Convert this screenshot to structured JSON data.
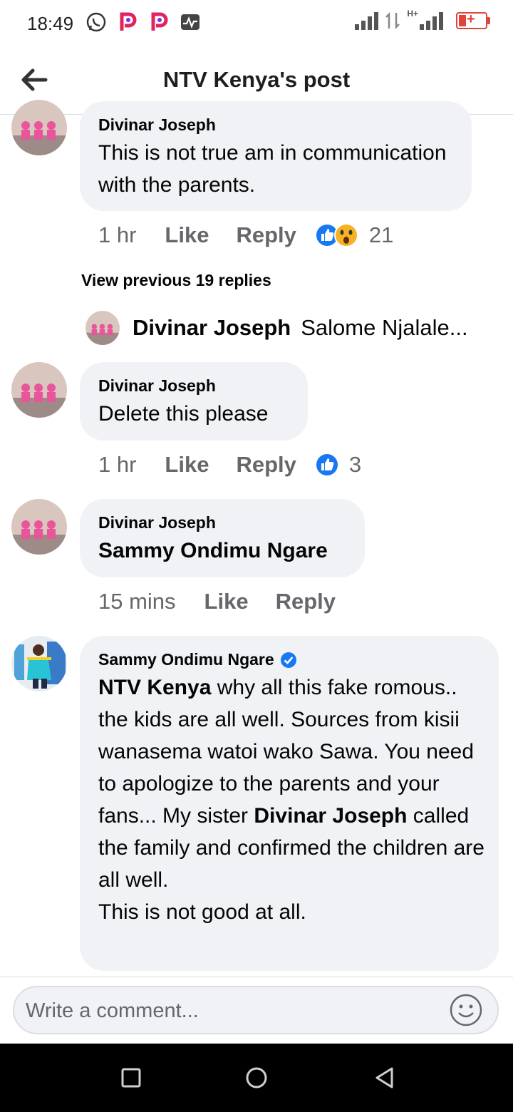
{
  "status_bar": {
    "time": "18:49",
    "network_label": "H+"
  },
  "header": {
    "title": "NTV Kenya's post",
    "back_icon": "back-arrow-icon"
  },
  "comments": [
    {
      "author": "Divinar Joseph",
      "text": "This is not true am in communication with the parents.",
      "time": "1 hr",
      "like_label": "Like",
      "reply_label": "Reply",
      "reactions": [
        "like",
        "wow"
      ],
      "reaction_count": "21"
    },
    {
      "view_previous_label": "View previous 19 replies"
    },
    {
      "inline_reply_author": "Divinar Joseph",
      "inline_reply_preview": "Salome Njalale..."
    },
    {
      "author": "Divinar Joseph",
      "text": "Delete this please",
      "time": "1 hr",
      "like_label": "Like",
      "reply_label": "Reply",
      "reactions": [
        "like"
      ],
      "reaction_count": "3"
    },
    {
      "author": "Divinar Joseph",
      "text": "Sammy Ondimu Ngare",
      "time": "15 mins",
      "like_label": "Like",
      "reply_label": "Reply"
    },
    {
      "author": "Sammy Ondimu Ngare",
      "verified": true,
      "text_parts": [
        {
          "bold": true,
          "t": "NTV Kenya"
        },
        {
          "bold": false,
          "t": " why all this fake romous.. the kids are all well. Sources from kisii wanasema watoi wako Sawa. You need to apologize to the parents and your fans... My sister "
        },
        {
          "bold": true,
          "t": "Divinar Joseph"
        },
        {
          "bold": false,
          "t": " called the family and confirmed the children are all well."
        },
        {
          "bold": false,
          "t": "This is not good at all."
        }
      ]
    }
  ],
  "composer": {
    "placeholder": "Write a comment..."
  },
  "colors": {
    "bubble": "#f0f2f5",
    "meta_text": "#65676b",
    "like_blue": "#1877f2",
    "divider": "#dadde1"
  }
}
